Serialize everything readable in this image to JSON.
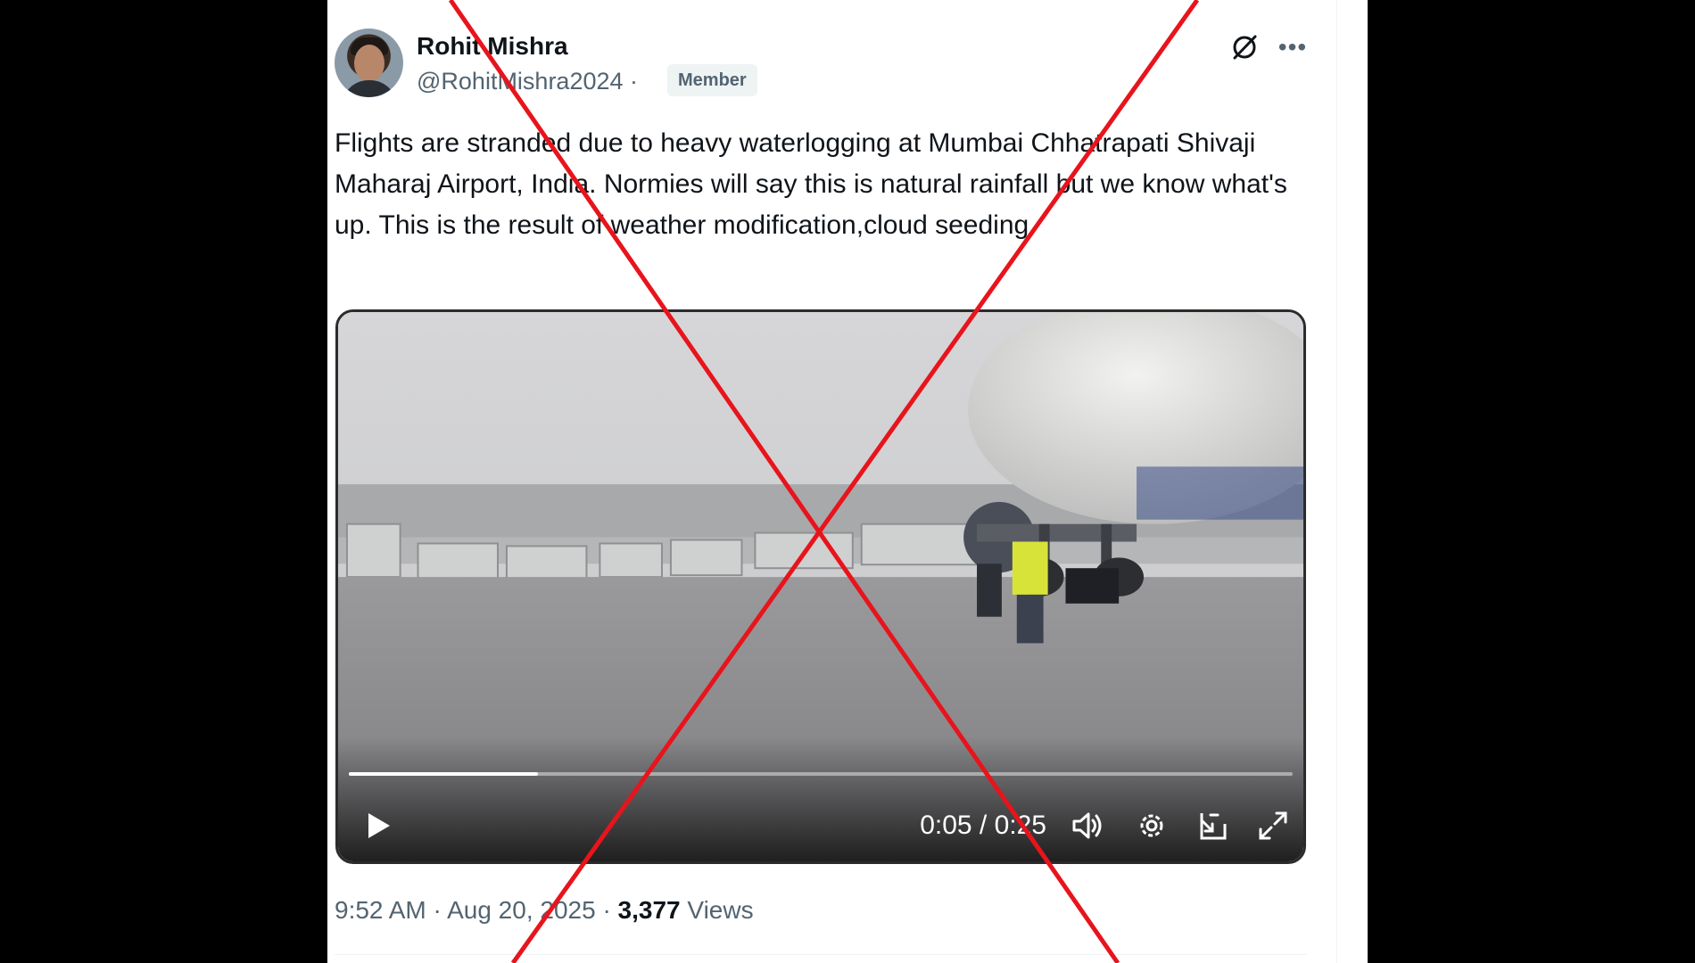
{
  "post": {
    "author_name": "Rohit Mishra",
    "handle": "@RohitMishra2024",
    "separator": "·",
    "badge": "Member",
    "text": "Flights are stranded due to heavy waterlogging at Mumbai Chhatrapati Shivaji Maharaj Airport, India. Normies will say this is natural rainfall but we know what's up. This is the result of weather modification,cloud seeding.",
    "timestamp": "9:52 AM · Aug 20, 2025 ·",
    "views_count": "3,377",
    "views_label": "Views",
    "icons": {
      "grok": "grok-icon",
      "more": "more-icon"
    }
  },
  "video": {
    "time": "0:05 / 0:25",
    "progress": 0.2,
    "icons": [
      "play-icon",
      "volume-icon",
      "gear-icon",
      "picture-in-picture-icon",
      "fullscreen-icon"
    ]
  },
  "overlay": {
    "mark": "red-x-icon",
    "color": "#e8141c"
  }
}
